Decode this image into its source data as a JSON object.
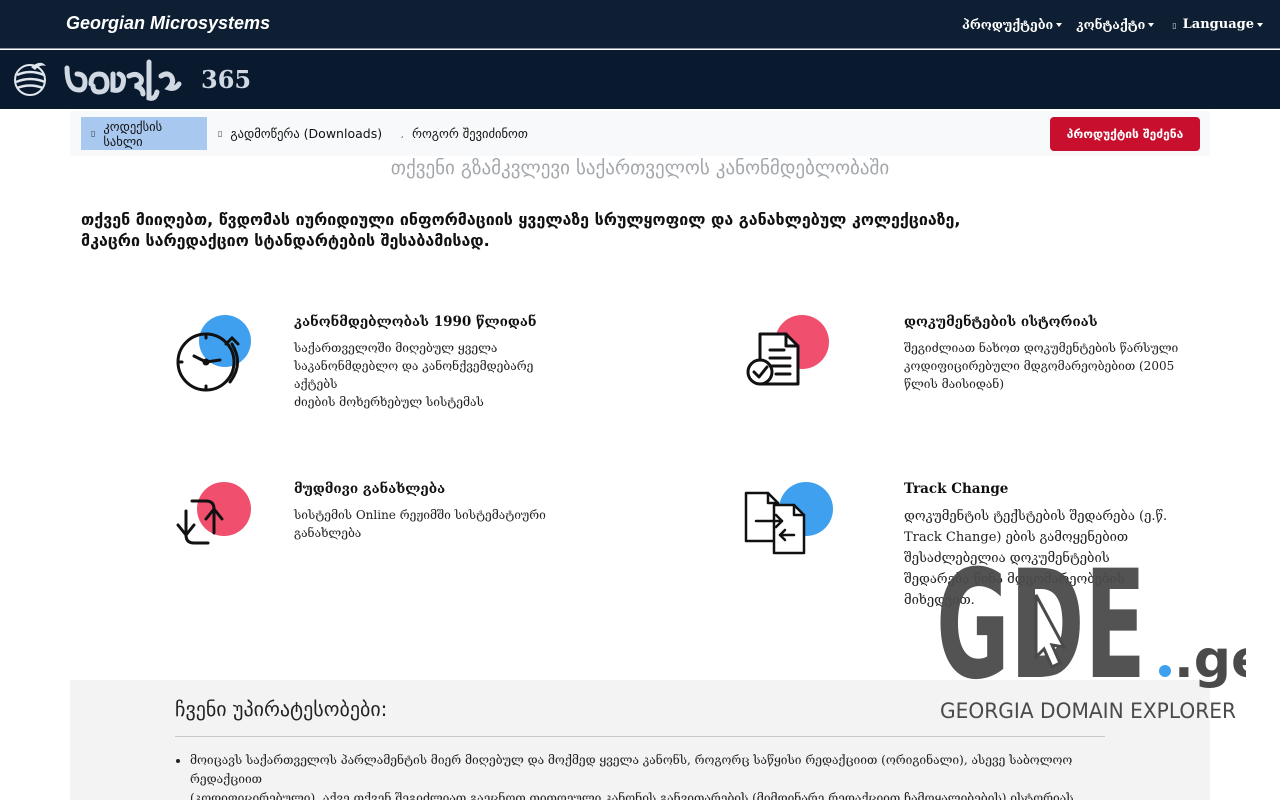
{
  "topbar": {
    "brand": "Georgian Microsystems",
    "nav": [
      {
        "label": "პროდუქტები"
      },
      {
        "label": "კონტაქტი"
      }
    ],
    "language": {
      "label": "Language",
      "icon": "globe-icon"
    }
  },
  "logo": {
    "wordmark": "კოდექსი",
    "number": "365"
  },
  "subnav": {
    "items": [
      {
        "label": "კოდექსის სახლი",
        "icon": "home-icon",
        "active": true
      },
      {
        "label": "გადმოწერა (Downloads)",
        "icon": "download-icon",
        "active": false
      },
      {
        "label": "როგორ შევიძინოთ",
        "icon": "question-icon",
        "active": false
      }
    ],
    "buy_button": "პროდუქტის შეძენა"
  },
  "tagline": "თქვენი გზამკვლევი საქართველოს კანონმდებლობაში",
  "intro": {
    "line1": "თქვენ მიიღებთ, წვდომას იურიდიული ინფორმაციის ყველაზე სრულყოფილ და განახლებულ კოლექციაზე,",
    "line2": "მკაცრი სარედაქციო სტანდარტების შესაბამისად."
  },
  "features": [
    {
      "title": "კანონმდებლობას 1990 წლიდან",
      "lines": [
        "საქართველოში მიღებულ ყველა",
        "საკანონმდებლო და კანონქვემდებარე",
        "აქტებს",
        "ძიების მოხერხებულ სისტემას"
      ],
      "icon": "clock-refresh-icon",
      "accent": "#3fa0f0"
    },
    {
      "title": "დოკუმენტების ისტორიას",
      "lines": [
        "შეგიძლიათ ნახოთ დოკუმენტების წარსული",
        "კოდიფიცირებული მდგომარეობებით (2005",
        "წლის მაისიდან)"
      ],
      "icon": "document-check-icon",
      "accent": "#f0506e"
    },
    {
      "title": "მუდმივი განახლება",
      "lines": [
        "სისტემის Online რეჟიმში სისტემატიური",
        "განახლება"
      ],
      "icon": "sync-arrows-icon",
      "accent": "#f0506e"
    },
    {
      "title": "Track Change",
      "lines": [
        "დოკუმენტის ტექსტების შედარება (ე.წ.",
        "Track Change) ების გამოყენებით",
        "შესაძლებელია დოკუმენტების",
        "შედარება წინა მდგომარეობების",
        "მიხედვით."
      ],
      "icon": "document-compare-icon",
      "accent": "#3fa0f0"
    }
  ],
  "watermark": {
    "word": "GDE",
    "suffix": ".ge",
    "subtitle": "GEORGIA DOMAIN EXPLORER"
  },
  "advantages": {
    "heading": "ჩვენი უპირატესობები:",
    "items": [
      {
        "line1": "მოიცავს საქართველოს პარლამენტის მიერ მიღებულ და მოქმედ ყველა კანონს, როგორც საწყისი რედაქციით (ორიგინალი), ასევე საბოლოო რედაქციით",
        "line2": "(კოდიფიცირებული). აქვე თქვენ შეგიძლიათ გაეცნოთ თითოეული კანონის განვითარების (მიმდინარე რედაქციით ჩამოყალიბების) ისტორიას."
      }
    ]
  },
  "colors": {
    "navbar": "#0f1f33",
    "logoband": "#0a1a2e",
    "subnav_active": "#a9c8f0",
    "buy_button": "#c8102e",
    "accent_blue": "#3fa0f0",
    "accent_pink": "#f0506e"
  }
}
